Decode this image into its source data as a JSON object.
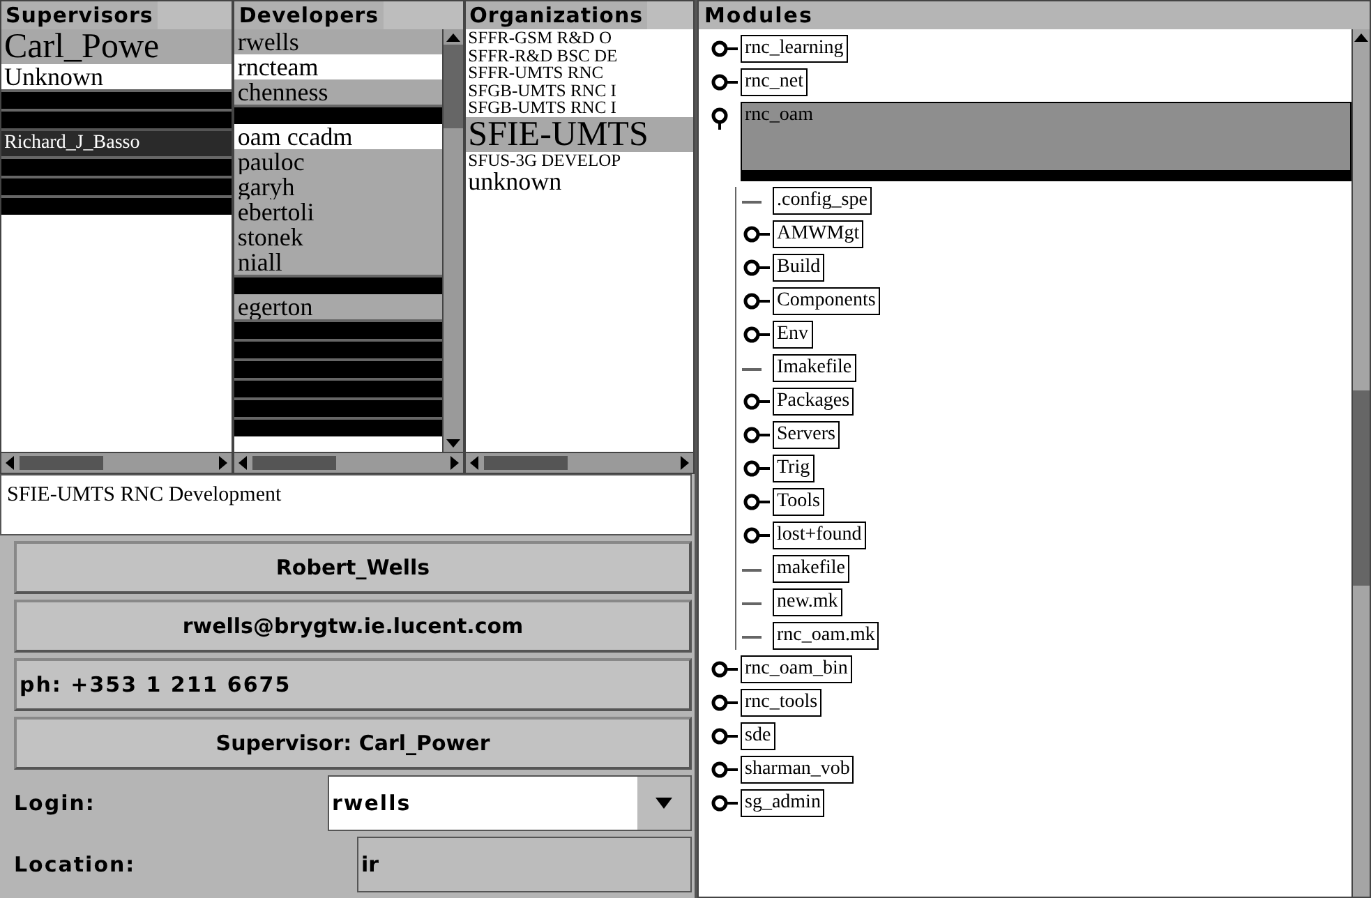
{
  "supervisors": {
    "title": "Supervisors",
    "items": [
      {
        "kind": "large",
        "text": "Carl_Powe",
        "selected": true
      },
      {
        "kind": "medium",
        "text": "Unknown",
        "selected": false
      },
      {
        "kind": "redacted"
      },
      {
        "kind": "redacted"
      },
      {
        "kind": "dark",
        "text": "Richard_J_Basso"
      },
      {
        "kind": "redacted"
      },
      {
        "kind": "redacted"
      },
      {
        "kind": "redacted"
      }
    ]
  },
  "developers": {
    "title": "Developers",
    "items": [
      {
        "kind": "medium",
        "text": "rwells",
        "selected": true
      },
      {
        "kind": "medium",
        "text": "rncteam",
        "selected": false
      },
      {
        "kind": "medium",
        "text": "chenness",
        "selected": true
      },
      {
        "kind": "redacted"
      },
      {
        "kind": "medium",
        "text": "oam ccadm",
        "selected": false
      },
      {
        "kind": "medium",
        "text": "pauloc",
        "selected": true
      },
      {
        "kind": "medium",
        "text": "garyh",
        "selected": true
      },
      {
        "kind": "medium",
        "text": "ebertoli",
        "selected": true
      },
      {
        "kind": "medium",
        "text": "stonek",
        "selected": true
      },
      {
        "kind": "medium",
        "text": "niall",
        "selected": true
      },
      {
        "kind": "redacted"
      },
      {
        "kind": "medium",
        "text": "egerton",
        "selected": true
      },
      {
        "kind": "redacted"
      },
      {
        "kind": "redacted"
      },
      {
        "kind": "redacted"
      },
      {
        "kind": "redacted"
      },
      {
        "kind": "redacted"
      },
      {
        "kind": "redacted"
      }
    ]
  },
  "organizations": {
    "title": "Organizations",
    "items": [
      {
        "kind": "small",
        "text": "SFFR-GSM R&D O",
        "selected": false
      },
      {
        "kind": "small",
        "text": "SFFR-R&D BSC DE",
        "selected": false
      },
      {
        "kind": "small",
        "text": "SFFR-UMTS RNC",
        "selected": false
      },
      {
        "kind": "small",
        "text": "SFGB-UMTS RNC I",
        "selected": false
      },
      {
        "kind": "small",
        "text": "SFGB-UMTS RNC I",
        "selected": false
      },
      {
        "kind": "large",
        "text": "SFIE-UMTS",
        "selected": true
      },
      {
        "kind": "small",
        "text": "SFUS-3G DEVELOP",
        "selected": false
      },
      {
        "kind": "medium",
        "text": "unknown",
        "selected": false
      }
    ]
  },
  "organization_field": {
    "value": "SFIE-UMTS RNC Development"
  },
  "details": [
    {
      "kind": "centered",
      "text": "Robert_Wells"
    },
    {
      "kind": "centered",
      "text": "rwells@brygtw.ie.lucent.com"
    },
    {
      "kind": "left",
      "text": "ph: +353 1 211 6675"
    },
    {
      "kind": "centered",
      "text": "Supervisor: Carl_Power"
    }
  ],
  "login": {
    "label": "Login:",
    "value": "rwells"
  },
  "location": {
    "label": "Location:",
    "value": "ir"
  },
  "modules": {
    "title": "Modules",
    "tree": [
      {
        "kind": "folder",
        "name": "rnc_learning",
        "expanded": false,
        "selected": false
      },
      {
        "kind": "folder",
        "name": "rnc_net",
        "expanded": false,
        "selected": false
      },
      {
        "kind": "folder",
        "name": "rnc_oam",
        "expanded": true,
        "selected": true,
        "children": [
          {
            "kind": "file",
            "name": ".config_spe",
            "selected": false
          },
          {
            "kind": "folder",
            "name": "AMWMgt",
            "expanded": false,
            "selected": false
          },
          {
            "kind": "folder",
            "name": "Build",
            "expanded": false,
            "selected": false
          },
          {
            "kind": "folder",
            "name": "Components",
            "expanded": false,
            "selected": false
          },
          {
            "kind": "folder",
            "name": "Env",
            "expanded": false,
            "selected": false
          },
          {
            "kind": "file",
            "name": "Imakefile",
            "selected": false
          },
          {
            "kind": "folder",
            "name": "Packages",
            "expanded": false,
            "selected": false
          },
          {
            "kind": "folder",
            "name": "Servers",
            "expanded": false,
            "selected": false
          },
          {
            "kind": "folder",
            "name": "Trig",
            "expanded": false,
            "selected": false
          },
          {
            "kind": "folder",
            "name": "Tools",
            "expanded": false,
            "selected": false
          },
          {
            "kind": "folder",
            "name": "lost+found",
            "expanded": false,
            "selected": false
          },
          {
            "kind": "file",
            "name": "makefile",
            "selected": false
          },
          {
            "kind": "file",
            "name": "new.mk",
            "selected": false
          },
          {
            "kind": "file",
            "name": "rnc_oam.mk",
            "selected": false
          }
        ]
      },
      {
        "kind": "folder",
        "name": "rnc_oam_bin",
        "expanded": false,
        "selected": false
      },
      {
        "kind": "folder",
        "name": "rnc_tools",
        "expanded": false,
        "selected": false
      },
      {
        "kind": "folder",
        "name": "sde",
        "expanded": false,
        "selected": false
      },
      {
        "kind": "folder",
        "name": "sharman_vob",
        "expanded": false,
        "selected": false
      },
      {
        "kind": "folder",
        "name": "sg_admin",
        "expanded": false,
        "selected": false
      }
    ]
  }
}
